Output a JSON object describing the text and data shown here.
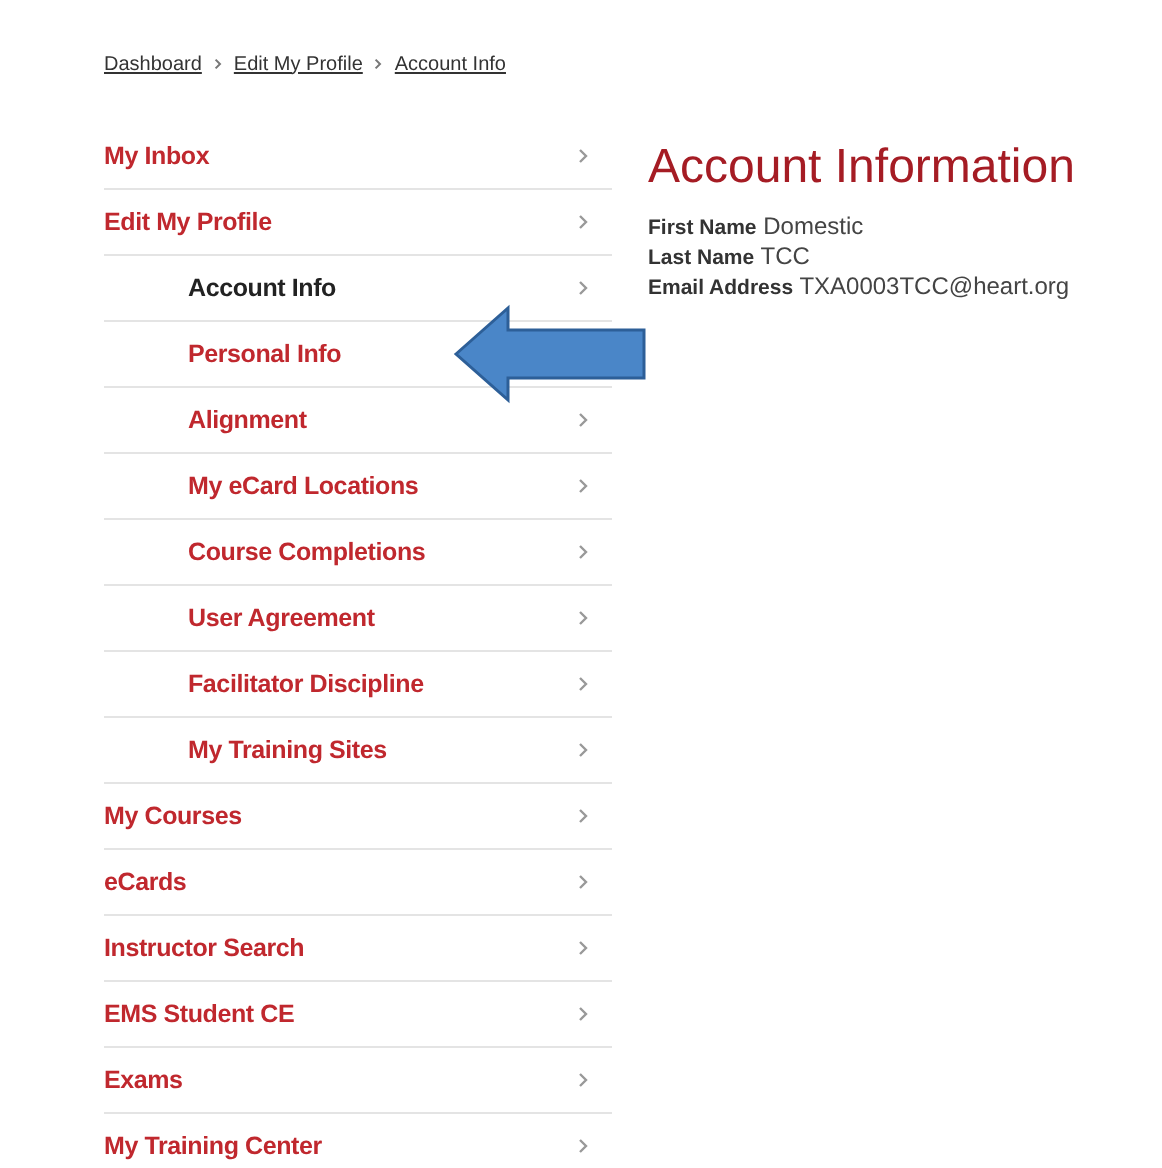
{
  "breadcrumb": [
    "Dashboard",
    "Edit My Profile",
    "Account Info"
  ],
  "sidebar": {
    "items": [
      {
        "label": "My Inbox",
        "selected": false
      },
      {
        "label": "Edit My Profile",
        "selected": false,
        "children": [
          {
            "label": "Account Info",
            "selected": true
          },
          {
            "label": "Personal Info",
            "selected": false
          },
          {
            "label": "Alignment",
            "selected": false
          },
          {
            "label": "My eCard Locations",
            "selected": false
          },
          {
            "label": "Course Completions",
            "selected": false
          },
          {
            "label": "User Agreement",
            "selected": false
          },
          {
            "label": "Facilitator Discipline",
            "selected": false
          },
          {
            "label": "My Training Sites",
            "selected": false
          }
        ]
      },
      {
        "label": "My Courses",
        "selected": false
      },
      {
        "label": "eCards",
        "selected": false
      },
      {
        "label": "Instructor Search",
        "selected": false
      },
      {
        "label": "EMS Student CE",
        "selected": false
      },
      {
        "label": "Exams",
        "selected": false
      },
      {
        "label": "My Training Center",
        "selected": false
      }
    ]
  },
  "content": {
    "title": "Account Information",
    "fields": [
      {
        "label": "First Name",
        "value": "Domestic"
      },
      {
        "label": "Last Name",
        "value": "TCC"
      },
      {
        "label": "Email Address",
        "value": "TXA0003TCC@heart.org"
      }
    ]
  },
  "annotation": {
    "kind": "arrow"
  }
}
